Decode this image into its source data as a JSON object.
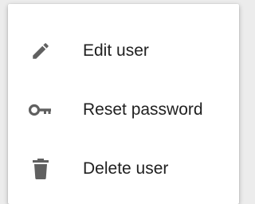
{
  "menu": {
    "items": [
      {
        "label": "Edit user",
        "icon": "pencil-icon"
      },
      {
        "label": "Reset password",
        "icon": "key-icon"
      },
      {
        "label": "Delete user",
        "icon": "trash-icon"
      }
    ]
  },
  "colors": {
    "icon": "#606060",
    "text": "#212121",
    "background": "#ffffff"
  }
}
